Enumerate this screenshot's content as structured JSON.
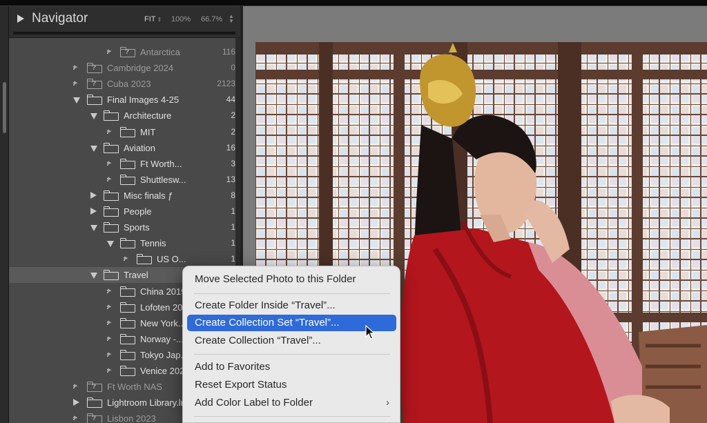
{
  "navigator": {
    "title": "Navigator",
    "zoom_fit": "FIT",
    "zoom_100": "100%",
    "zoom_667": "66.7%"
  },
  "folders": [
    {
      "name": "Antarctica",
      "count": "116",
      "level": 2,
      "state": "sub",
      "dim": true,
      "missing": true
    },
    {
      "name": "Cambridge 2024",
      "count": "0",
      "level": 0,
      "state": "sub",
      "dim": true,
      "missing": true
    },
    {
      "name": "Cuba 2023",
      "count": "2123",
      "level": 0,
      "state": "sub",
      "dim": true,
      "missing": true
    },
    {
      "name": "Final Images 4-25",
      "count": "44",
      "level": 0,
      "state": "open"
    },
    {
      "name": "Architecture",
      "count": "2",
      "level": 1,
      "state": "open"
    },
    {
      "name": "MIT",
      "count": "2",
      "level": 2,
      "state": "sub"
    },
    {
      "name": "Aviation",
      "count": "16",
      "level": 1,
      "state": "open"
    },
    {
      "name": "Ft Worth...",
      "count": "3",
      "level": 2,
      "state": "sub"
    },
    {
      "name": "Shuttlesw...",
      "count": "13",
      "level": 2,
      "state": "sub"
    },
    {
      "name": "Misc finals ƒ",
      "count": "8",
      "level": 1,
      "state": "closed"
    },
    {
      "name": "People",
      "count": "1",
      "level": 1,
      "state": "closed"
    },
    {
      "name": "Sports",
      "count": "1",
      "level": 1,
      "state": "open"
    },
    {
      "name": "Tennis",
      "count": "1",
      "level": 2,
      "state": "open"
    },
    {
      "name": "US O...",
      "count": "1",
      "level": 3,
      "state": "sub"
    },
    {
      "name": "Travel",
      "count": "",
      "level": 1,
      "state": "open",
      "selected": true
    },
    {
      "name": "China 2019...",
      "count": "",
      "level": 2,
      "state": "sub"
    },
    {
      "name": "Lofoten 20...",
      "count": "",
      "level": 2,
      "state": "sub"
    },
    {
      "name": "New York...",
      "count": "",
      "level": 2,
      "state": "sub"
    },
    {
      "name": "Norway -...",
      "count": "",
      "level": 2,
      "state": "sub"
    },
    {
      "name": "Tokyo Jap...",
      "count": "",
      "level": 2,
      "state": "sub"
    },
    {
      "name": "Venice 202...",
      "count": "",
      "level": 2,
      "state": "sub"
    },
    {
      "name": "Ft Worth NAS",
      "count": "",
      "level": 0,
      "state": "sub",
      "dim": true,
      "missing": true
    },
    {
      "name": "Lightroom Library.lr...",
      "count": "",
      "level": 0,
      "state": "closed"
    },
    {
      "name": "Lisbon 2023",
      "count": "",
      "level": 0,
      "state": "sub",
      "dim": true,
      "missing": true
    }
  ],
  "context_menu": {
    "move_photo": "Move Selected Photo to this Folder",
    "create_folder": "Create Folder Inside “Travel”...",
    "create_collection_set": "Create Collection Set “Travel”...",
    "create_collection": "Create Collection “Travel”...",
    "add_favorites": "Add to Favorites",
    "reset_export": "Reset Export Status",
    "add_color_label": "Add Color Label to Folder"
  },
  "colors": {
    "panel_bg": "#494949",
    "menu_bg": "#e9e9ea",
    "menu_highlight": "#2f6ad9"
  },
  "icons": {
    "navigator_toggle": "disclosure-triangle-icon",
    "folder": "folder-icon",
    "missing_folder": "missing-folder-icon",
    "cursor": "mouse-pointer-icon"
  }
}
